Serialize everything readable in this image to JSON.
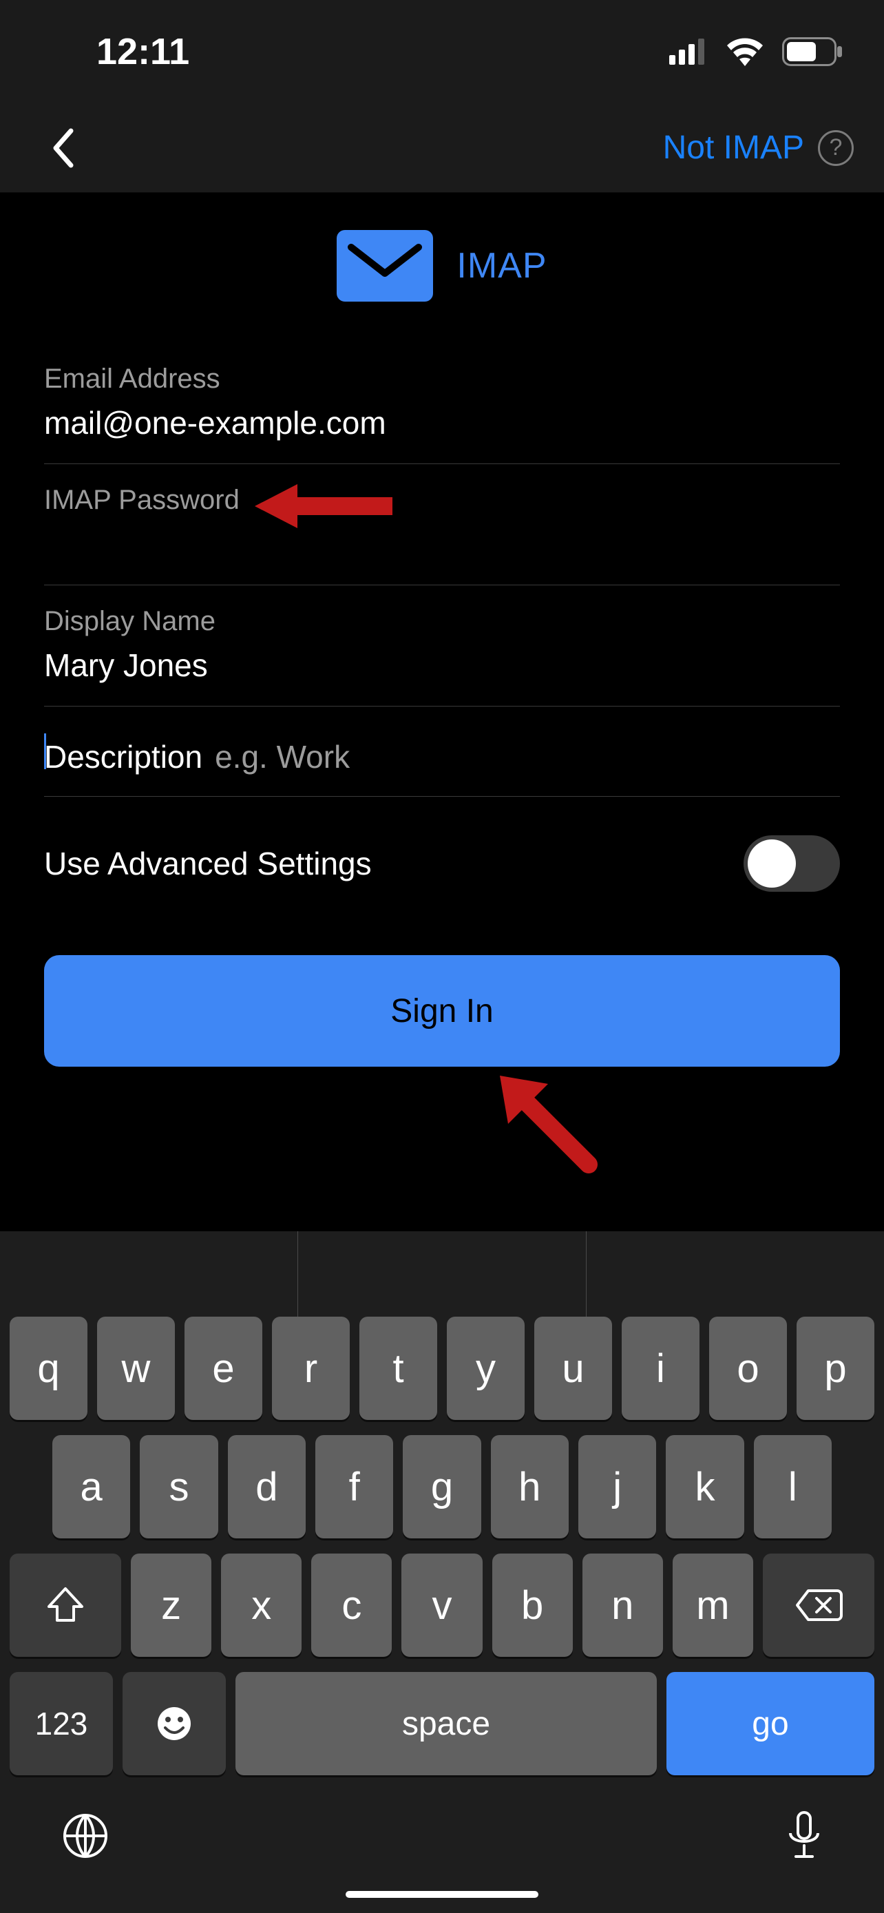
{
  "statusbar": {
    "time": "12:11"
  },
  "nav": {
    "not_imap": "Not IMAP"
  },
  "header": {
    "title": "IMAP"
  },
  "fields": {
    "email": {
      "label": "Email Address",
      "value": "mail@one-example.com"
    },
    "password": {
      "label": "IMAP Password",
      "value": ""
    },
    "displayName": {
      "label": "Display Name",
      "value": "Mary Jones"
    },
    "description": {
      "label": "Description",
      "placeholder": "e.g. Work",
      "value": ""
    }
  },
  "advanced": {
    "label": "Use Advanced Settings",
    "on": false
  },
  "actions": {
    "signin": "Sign In"
  },
  "keyboard": {
    "row1": [
      "q",
      "w",
      "e",
      "r",
      "t",
      "y",
      "u",
      "i",
      "o",
      "p"
    ],
    "row2": [
      "a",
      "s",
      "d",
      "f",
      "g",
      "h",
      "j",
      "k",
      "l"
    ],
    "row3": [
      "z",
      "x",
      "c",
      "v",
      "b",
      "n",
      "m"
    ],
    "num": "123",
    "space": "space",
    "go": "go"
  },
  "colors": {
    "accent": "#3f87f5",
    "annotation": "#c21a1a"
  }
}
